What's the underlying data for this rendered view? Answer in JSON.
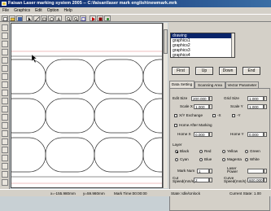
{
  "window": {
    "title": "Faisan Laser marking system 2005 -- C:\\faisan\\laser mark english\\newmark.mrk"
  },
  "menu": [
    "File",
    "Graphics",
    "Edit",
    "Option",
    "Help"
  ],
  "graphics_list": [
    "drawing",
    "graphics1",
    "graphics2",
    "graphics3",
    "graphics4"
  ],
  "buttons": {
    "first": "First",
    "up": "Up",
    "down": "Down",
    "end": "End"
  },
  "tabs": [
    "Data Setting",
    "Scanning Area",
    "Vector Parameter"
  ],
  "data_setting": {
    "edit_size_label": "Edit Size",
    "edit_size_value": "200.000",
    "grid_size_label": "Grid Size",
    "grid_size_value": "1.000",
    "scale_x_label": "Scale X",
    "scale_x_value": "1.000",
    "scale_y_label": "Scale Y",
    "scale_y_value": "1.000",
    "xy_exchange_label": "X/Y Exchange",
    "neg_x_label": "-X",
    "neg_y_label": "-Y",
    "home_after_marking_label": "Home After Marking",
    "home_x_label": "Home X",
    "home_x_value": "0.000",
    "home_y_label": "Home Y",
    "home_y_value": "0.000",
    "layer_label": "Layer",
    "colors": [
      "Black",
      "Red",
      "Yellow",
      "Green",
      "Cyan",
      "Blue",
      "Magenta",
      "White"
    ],
    "mark_num_label": "Mark Num",
    "mark_num_value": "1",
    "laser_power_label": "Laser Power",
    "laser_power_value": "",
    "cut_speed_label": "Cut Speed(mm/s)",
    "cut_speed_value": "2",
    "curve_speed_label": "Curve Speed(mm/s)",
    "curve_speed_value": "600.000"
  },
  "status": {
    "x": "x=-155.980mm",
    "y": "y=59.980mm",
    "mark_time": "Mark Time:00:00:00",
    "state": "State: Idle/Unlock",
    "current_state": "Current State: 1.00"
  }
}
